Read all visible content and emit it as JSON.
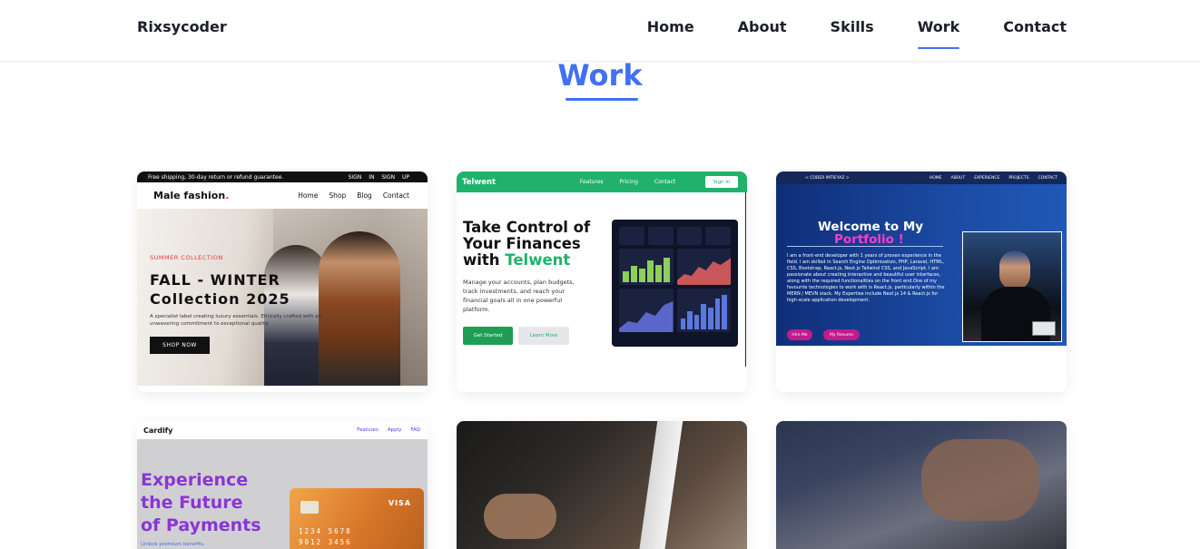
{
  "header": {
    "brand": "Rixsycoder",
    "nav": [
      "Home",
      "About",
      "Skills",
      "Work",
      "Contact"
    ],
    "active": "Work"
  },
  "section": {
    "title": "Work"
  },
  "projects": [
    {
      "name": "Male fashion",
      "topbar_left": "Free shipping, 30-day return or refund guarantee.",
      "topbar_right": "SIGN IN   SIGN UP",
      "logo": "Male fashion",
      "nav": [
        "Home",
        "Shop",
        "Blog",
        "Contact"
      ],
      "subtitle": "SUMMER COLLECTION",
      "heading_line1": "FALL - WINTER",
      "heading_line2": "Collection 2025",
      "description": "A specialist label creating luxury essentials. Ethically crafted with an unwavering commitment to exceptional quality.",
      "button": "SHOP NOW"
    },
    {
      "name": "Telwent",
      "logo": "Telwent",
      "nav": [
        "Features",
        "Pricing",
        "Contact"
      ],
      "sign_in": "Sign In",
      "heading_line1": "Take Control of",
      "heading_line2": "Your Finances",
      "heading_line3_prefix": "with",
      "heading_highlight": "Telwent",
      "description": "Manage your accounts, plan budgets, track investments, and reach your financial goals all in one powerful platform.",
      "primary_button": "Get Started",
      "secondary_button": "Learn More"
    },
    {
      "name": "Portfolio",
      "logo": "< CODER IMTIEYAZ >",
      "nav": [
        "HOME",
        "ABOUT",
        "EXPERIENCE",
        "PROJECTS",
        "CONTACT"
      ],
      "heading_line1": "Welcome to My",
      "heading_highlight": "Portfolio !",
      "description": "I am a front-end developer with 1 years of proven experience in the field. I am skilled in Search Engine Optimization, PHP, Laravel, HTML, CSS, Bootstrap, React.js, Next.js Tailwind CSS, and JavaScript. I am passionate about creating interactive and beautiful user interfaces, along with the required functionalities on the front end.One of my favourite technologies to work with is React.js, particularly within the MERN / MEVN stack. My Expertise include Next.js 14 & React.js for high-scale application development.",
      "button1": "Hire Me",
      "button2": "My Resume"
    },
    {
      "name": "Cardify",
      "logo": "Cardify",
      "nav": [
        "Features",
        "Apply",
        "FAQ"
      ],
      "heading_line1": "Experience",
      "heading_line2": "the Future",
      "heading_line3": "of Payments",
      "subtext": "Unlock premium benefits.",
      "card_brand": "VISA",
      "card_number_line1": "1234  5678",
      "card_number_line2": "9012  3456"
    },
    {
      "name": "Workspace photo"
    },
    {
      "name": "Laptop typing photo"
    }
  ],
  "colors": {
    "accent": "#4070f4",
    "fashion_red": "#e53637",
    "telwent_green": "#20b26c",
    "portfolio_pink": "#ff3dc8",
    "cardify_purple": "#8b35d6"
  },
  "icons": {
    "apple_logo": "apple-logo-icon"
  }
}
